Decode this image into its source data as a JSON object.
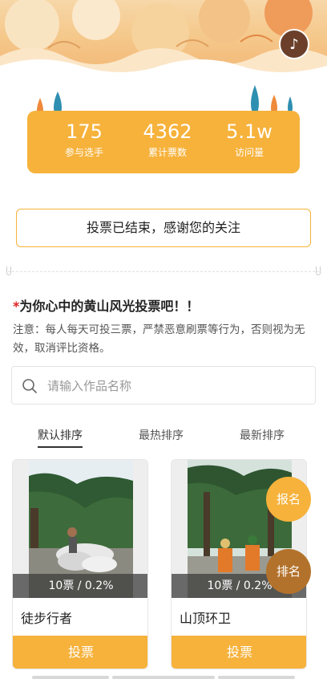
{
  "banner": {
    "music_icon": "music-note-icon"
  },
  "stats": [
    {
      "value": "175",
      "label": "参与选手"
    },
    {
      "value": "4362",
      "label": "累计票数"
    },
    {
      "value": "5.1w",
      "label": "访问量"
    }
  ],
  "notice": "投票已结束，感谢您的关注",
  "section": {
    "star": "*",
    "title": "为你心中的黄山风光投票吧！！",
    "rules": "注意：每人每天可投三票，严禁恶意刷票等行为，否则视为无效，取消评比资格。"
  },
  "search": {
    "placeholder": "请输入作品名称",
    "value": ""
  },
  "tabs": [
    {
      "label": "默认排序",
      "active": true
    },
    {
      "label": "最热排序",
      "active": false
    },
    {
      "label": "最新排序",
      "active": false
    }
  ],
  "entries": [
    {
      "votes_text": "10票 / 0.2%",
      "name": "徒步行者",
      "button": "投票"
    },
    {
      "votes_text": "10票 / 0.2%",
      "name": "山顶环卫",
      "button": "投票"
    }
  ],
  "floating": {
    "signup": "报名",
    "ranking": "排名"
  },
  "colors": {
    "accent": "#f6b23b",
    "ranking": "#b3722c",
    "text_dark": "#222222"
  }
}
